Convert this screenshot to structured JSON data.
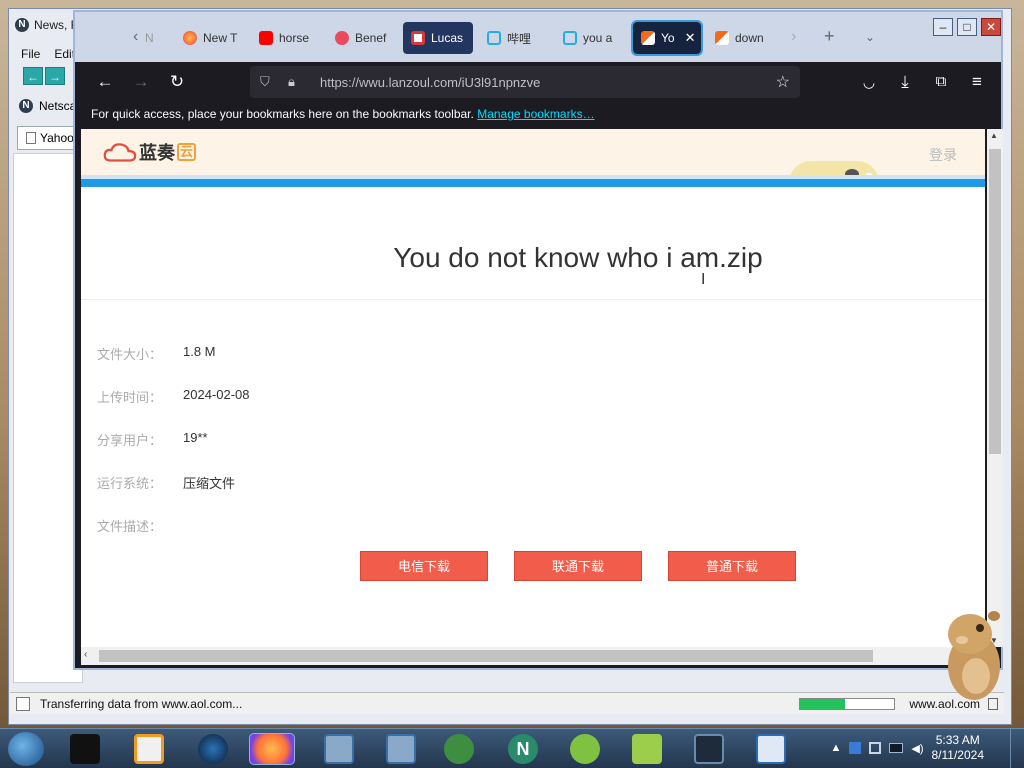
{
  "bg_window": {
    "title": "News, F",
    "menu": [
      "File",
      "Edit"
    ],
    "bookmark_item": "Netsca",
    "tab_item": "Yahoo"
  },
  "statusbar": {
    "text": "Transferring data from www.aol.com...",
    "host": "www.aol.com",
    "progress": 0.48
  },
  "firefox": {
    "tabs": [
      {
        "label": "N",
        "icon": "newspaper-icon",
        "color": "#888888"
      },
      {
        "label": "New T",
        "icon": "firefox-icon",
        "color": "#ff7139"
      },
      {
        "label": "horse",
        "icon": "youtube-icon",
        "color": "#ff0000"
      },
      {
        "label": "Benef",
        "icon": "heart-icon",
        "color": "#e84a5f"
      },
      {
        "label": "Lucas",
        "icon": "app-icon",
        "color": "#d63a3a"
      },
      {
        "label": "哔哩",
        "icon": "bilibili-icon",
        "color": "#23ade5"
      },
      {
        "label": "you a",
        "icon": "bilibili-icon",
        "color": "#23ade5"
      },
      {
        "label": "Yo",
        "icon": "lanzou-icon",
        "color": "#f26b1d"
      },
      {
        "label": "down",
        "icon": "lanzou-icon",
        "color": "#f26b1d"
      }
    ],
    "url": "https://wwu.lanzoul.com/iU3l91npnzve",
    "bookmarks_hint": "For quick access, place your bookmarks here on the bookmarks toolbar.",
    "manage_bookmarks": "Manage bookmarks…"
  },
  "page": {
    "site_name": "蓝奏",
    "site_badge": "云",
    "login": "登录",
    "file_title": "You do not know who i am.zip",
    "info": [
      {
        "label": "文件大小：",
        "value": "1.8 M"
      },
      {
        "label": "上传时间：",
        "value": "2024-02-08"
      },
      {
        "label": "分享用户：",
        "value": "19**"
      },
      {
        "label": "运行系统：",
        "value": "压缩文件"
      },
      {
        "label": "文件描述：",
        "value": ""
      }
    ],
    "buttons": [
      "电信下载",
      "联通下载",
      "普通下载"
    ]
  },
  "taskbar": {
    "time": "5:33 AM",
    "date": "8/11/2024"
  },
  "colors": {
    "download_button": "#f25c4b",
    "site_band": "#1f9be6",
    "firefox_chrome": "#1c1b22"
  }
}
